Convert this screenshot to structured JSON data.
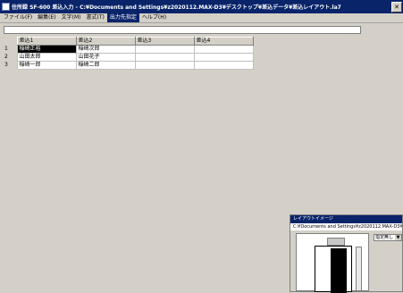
{
  "window": {
    "title": "住所録 SF-600 差込入力 - C:¥Documents and Settings¥z2020112.MAX-D3¥デスクトップ¥差込データ¥差込レイアウト.la7",
    "close_label": "✕"
  },
  "menu": {
    "items": [
      "ファイル(F)",
      "編集(E)",
      "文字(M)",
      "書式(T)",
      "出力先指定",
      "ヘルプ(H)"
    ],
    "active_index": 4
  },
  "grid": {
    "columns": [
      "差込1",
      "差込2",
      "差込3",
      "差込4"
    ],
    "rows": [
      {
        "num": "1",
        "cells": [
          "稲崎正裕",
          "稲崎次郎",
          "",
          ""
        ]
      },
      {
        "num": "2",
        "cells": [
          "山田太郎",
          "山田花子",
          "",
          ""
        ]
      },
      {
        "num": "3",
        "cells": [
          "稲崎一郎",
          "稲崎二郎",
          "",
          ""
        ]
      }
    ]
  },
  "layout_window": {
    "title": "レイアウトイメージ",
    "path": "C:¥Documents and Settings¥z2020112.MAX-D3¥デス",
    "dropdown_value": "指定無し"
  }
}
